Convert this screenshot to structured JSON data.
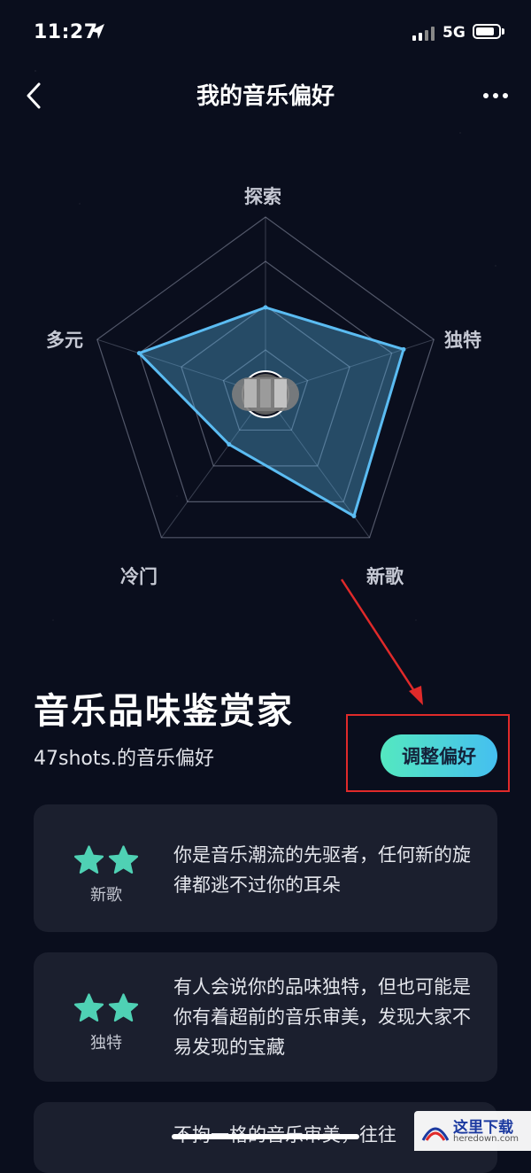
{
  "status": {
    "time": "11:27",
    "network": "5G"
  },
  "nav": {
    "title": "我的音乐偏好"
  },
  "radar": {
    "axes": [
      "探索",
      "独特",
      "新歌",
      "冷门",
      "多元"
    ],
    "values": [
      0.49,
      0.82,
      0.85,
      0.35,
      0.75
    ],
    "stroke": "#5bbcf2",
    "fill": "rgba(91,188,242,0.35)"
  },
  "profile": {
    "headline": "音乐品味鉴赏家",
    "subline": "47shots.的音乐偏好",
    "adjust_button": "调整偏好"
  },
  "cards": [
    {
      "stars": 2,
      "label": "新歌",
      "text": "你是音乐潮流的先驱者，任何新的旋律都逃不过你的耳朵"
    },
    {
      "stars": 2,
      "label": "独特",
      "text": "有人会说你的品味独特，但也可能是你有着超前的音乐审美，发现大家不易发现的宝藏"
    },
    {
      "text": "不拘一格的音乐审美，往往"
    }
  ],
  "watermark": {
    "title": "这里下载",
    "url": "heredown.com"
  },
  "colors": {
    "background": "#0a0e1d",
    "card": "#1b1f2e",
    "accent_start": "#54e8c0",
    "accent_end": "#45bff0",
    "star": "#4fd1b4",
    "highlight": "#e02a2a"
  }
}
